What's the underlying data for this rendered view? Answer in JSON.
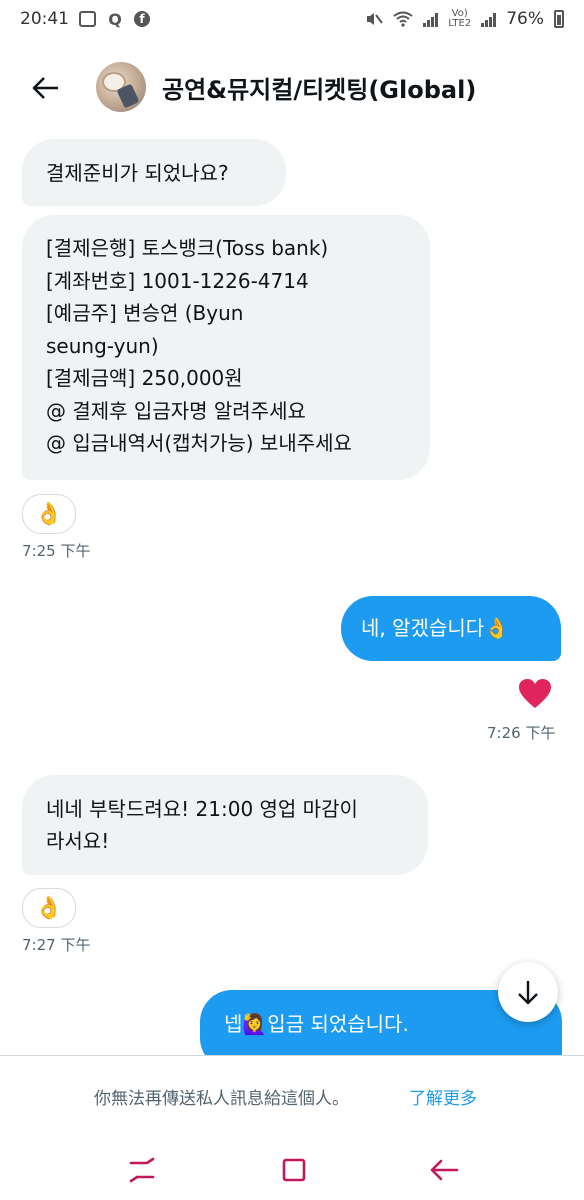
{
  "status_bar": {
    "time": "20:41",
    "network_label_top": "Vo)",
    "network_label_bottom": "LTE2",
    "battery": "76%"
  },
  "header": {
    "title": "공연&뮤지컬/티켓팅(Global)",
    "back_icon": "arrow-left-icon"
  },
  "messages": [
    {
      "direction": "in",
      "lines": [
        "결제준비가 되었나요?"
      ]
    },
    {
      "direction": "in",
      "lines": [
        "[결제은행] 토스뱅크(Toss bank)",
        "[계좌번호] 1001-1226-4714",
        "[예금주] 변승연 (Byun",
        "seung-yun)",
        "[결제금액] 250,000원",
        "@ 결제후 입금자명 알려주세요",
        "@ 입금내역서(캡처가능) 보내주세요"
      ],
      "reaction": "👌",
      "time": "7:25 下午"
    },
    {
      "direction": "out",
      "lines": [
        "네, 알겠습니다👌"
      ],
      "reaction": "❤️",
      "time": "7:26 下午"
    },
    {
      "direction": "in",
      "lines": [
        "네네 부탁드려요! 21:00 영업 마감이",
        "라서요!"
      ],
      "reaction": "👌",
      "time": "7:27 下午"
    },
    {
      "direction": "out",
      "lines": [
        "넵🙋‍♀️입금 되었습니다."
      ]
    }
  ],
  "footer": {
    "notice": "你無法再傳送私人訊息給這個人。",
    "link": "了解更多"
  },
  "colors": {
    "incoming_bubble": "#eff3f4",
    "outgoing_bubble": "#1d9bf0",
    "link": "#1d9bf0",
    "secondary_text": "#536471"
  }
}
